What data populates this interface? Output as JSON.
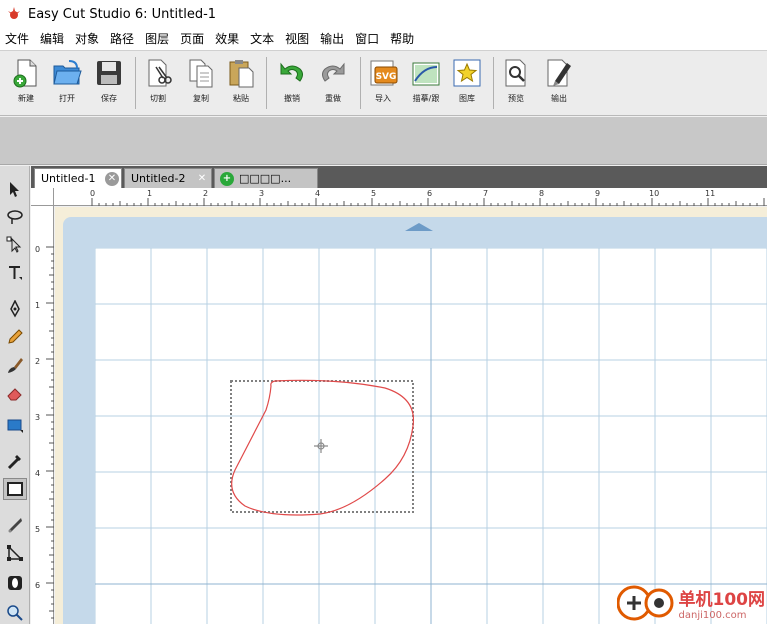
{
  "window": {
    "title": "Easy Cut Studio 6: Untitled-1"
  },
  "menu": [
    "文件",
    "编辑",
    "对象",
    "路径",
    "图层",
    "页面",
    "效果",
    "文本",
    "视图",
    "输出",
    "窗口",
    "帮助"
  ],
  "toolbar": {
    "new": "新建",
    "open": "打开",
    "save": "保存",
    "cut": "切割",
    "copy": "复制",
    "paste": "粘贴",
    "undo": "撤销",
    "redo": "重做",
    "import": "导入",
    "trace": "描摹/跟",
    "library": "图库",
    "preview": "预览",
    "output": "输出"
  },
  "tabs": [
    {
      "label": "Untitled-1"
    },
    {
      "label": "Untitled-2"
    },
    {
      "label": "□□□□..."
    }
  ],
  "ruler": {
    "top": [
      "0",
      "1",
      "2",
      "3",
      "4",
      "5",
      "6",
      "7",
      "8",
      "9",
      "10",
      "11"
    ],
    "left": [
      "0",
      "1",
      "2",
      "3",
      "4",
      "5",
      "6"
    ]
  },
  "watermark": {
    "cn": "单机100网",
    "url": "danji100.com"
  },
  "colors": {
    "shape_stroke": "#e04a4a",
    "mat": "#c5d9ea",
    "grid": "#b7d0e3",
    "selection": "#808080"
  }
}
